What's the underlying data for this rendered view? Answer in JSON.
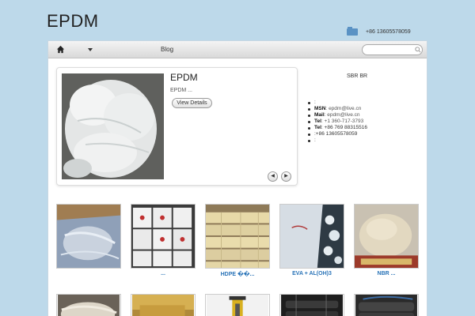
{
  "site": {
    "title": "EPDM",
    "top_phone": "+86 13605578059"
  },
  "nav": {
    "blog_label": "Blog",
    "search_placeholder": ""
  },
  "slider": {
    "title": "EPDM",
    "description": "EPDM ...",
    "button_label": "View Details",
    "prev_label": "◀",
    "next_label": "▶"
  },
  "sidebar": {
    "heading": "SBR BR",
    "contacts": [
      {
        "label": "",
        "value": ":"
      },
      {
        "label": "MSN",
        "value": ": epdm@live.cn"
      },
      {
        "label": "Mail",
        "value": ": epdm@live.cn"
      },
      {
        "label": "Tel",
        "value": ": +1 360-717-3793"
      },
      {
        "label": "Tel",
        "value": ": +86 769 88315516"
      },
      {
        "label": "",
        "value": ":+86 13605578059"
      },
      {
        "label": "",
        "value": ":"
      }
    ]
  },
  "products_row1": [
    {
      "caption": ""
    },
    {
      "caption": "..."
    },
    {
      "caption": "HDPE  ��..."
    },
    {
      "caption": "EVA + AL(OH)3"
    },
    {
      "caption": "NBR      ..."
    }
  ],
  "colors": {
    "background": "#bdd9ea",
    "link": "#2a74b8"
  }
}
